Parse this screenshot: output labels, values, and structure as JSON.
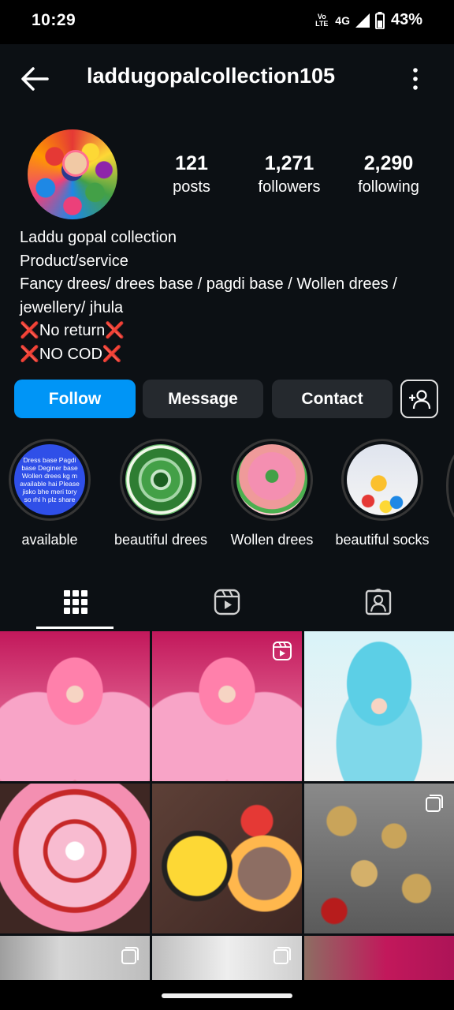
{
  "status_bar": {
    "time": "10:29",
    "volte": "Vo\nLTE",
    "network": "4G",
    "battery": "43%"
  },
  "header": {
    "username": "laddugopalcollection105",
    "back_icon": "arrow-left-icon",
    "more_icon": "more-vertical-icon"
  },
  "profile": {
    "stats": [
      {
        "value": "121",
        "label": "posts"
      },
      {
        "value": "1,271",
        "label": "followers"
      },
      {
        "value": "2,290",
        "label": "following"
      }
    ],
    "bio": {
      "name": "Laddu gopal collection",
      "category": "Product/service",
      "line1": "Fancy drees/ drees base / pagdi base / Wollen drees /",
      "line2": "jewellery/ jhula",
      "line3": "No return",
      "line4": "NO COD",
      "cross_mark": "❌"
    }
  },
  "actions": {
    "follow": "Follow",
    "message": "Message",
    "contact": "Contact",
    "add_user_icon": "add-user-icon"
  },
  "highlights": [
    {
      "label": "available",
      "cover_text": "Dress base Pagdi base Deginer base Wollen drees kg m available hai Please jisko bhe meri tory so rhi h plz share"
    },
    {
      "label": "beautiful drees"
    },
    {
      "label": "Wollen drees"
    },
    {
      "label": "beautiful socks"
    }
  ],
  "tabs": [
    {
      "icon": "grid-icon",
      "active": true
    },
    {
      "icon": "reels-icon",
      "active": false
    },
    {
      "icon": "tagged-icon",
      "active": false
    }
  ],
  "colors": {
    "background": "#0c1014",
    "follow_button": "#0095f6",
    "secondary_button": "#25292e",
    "cross": "#e53935"
  }
}
